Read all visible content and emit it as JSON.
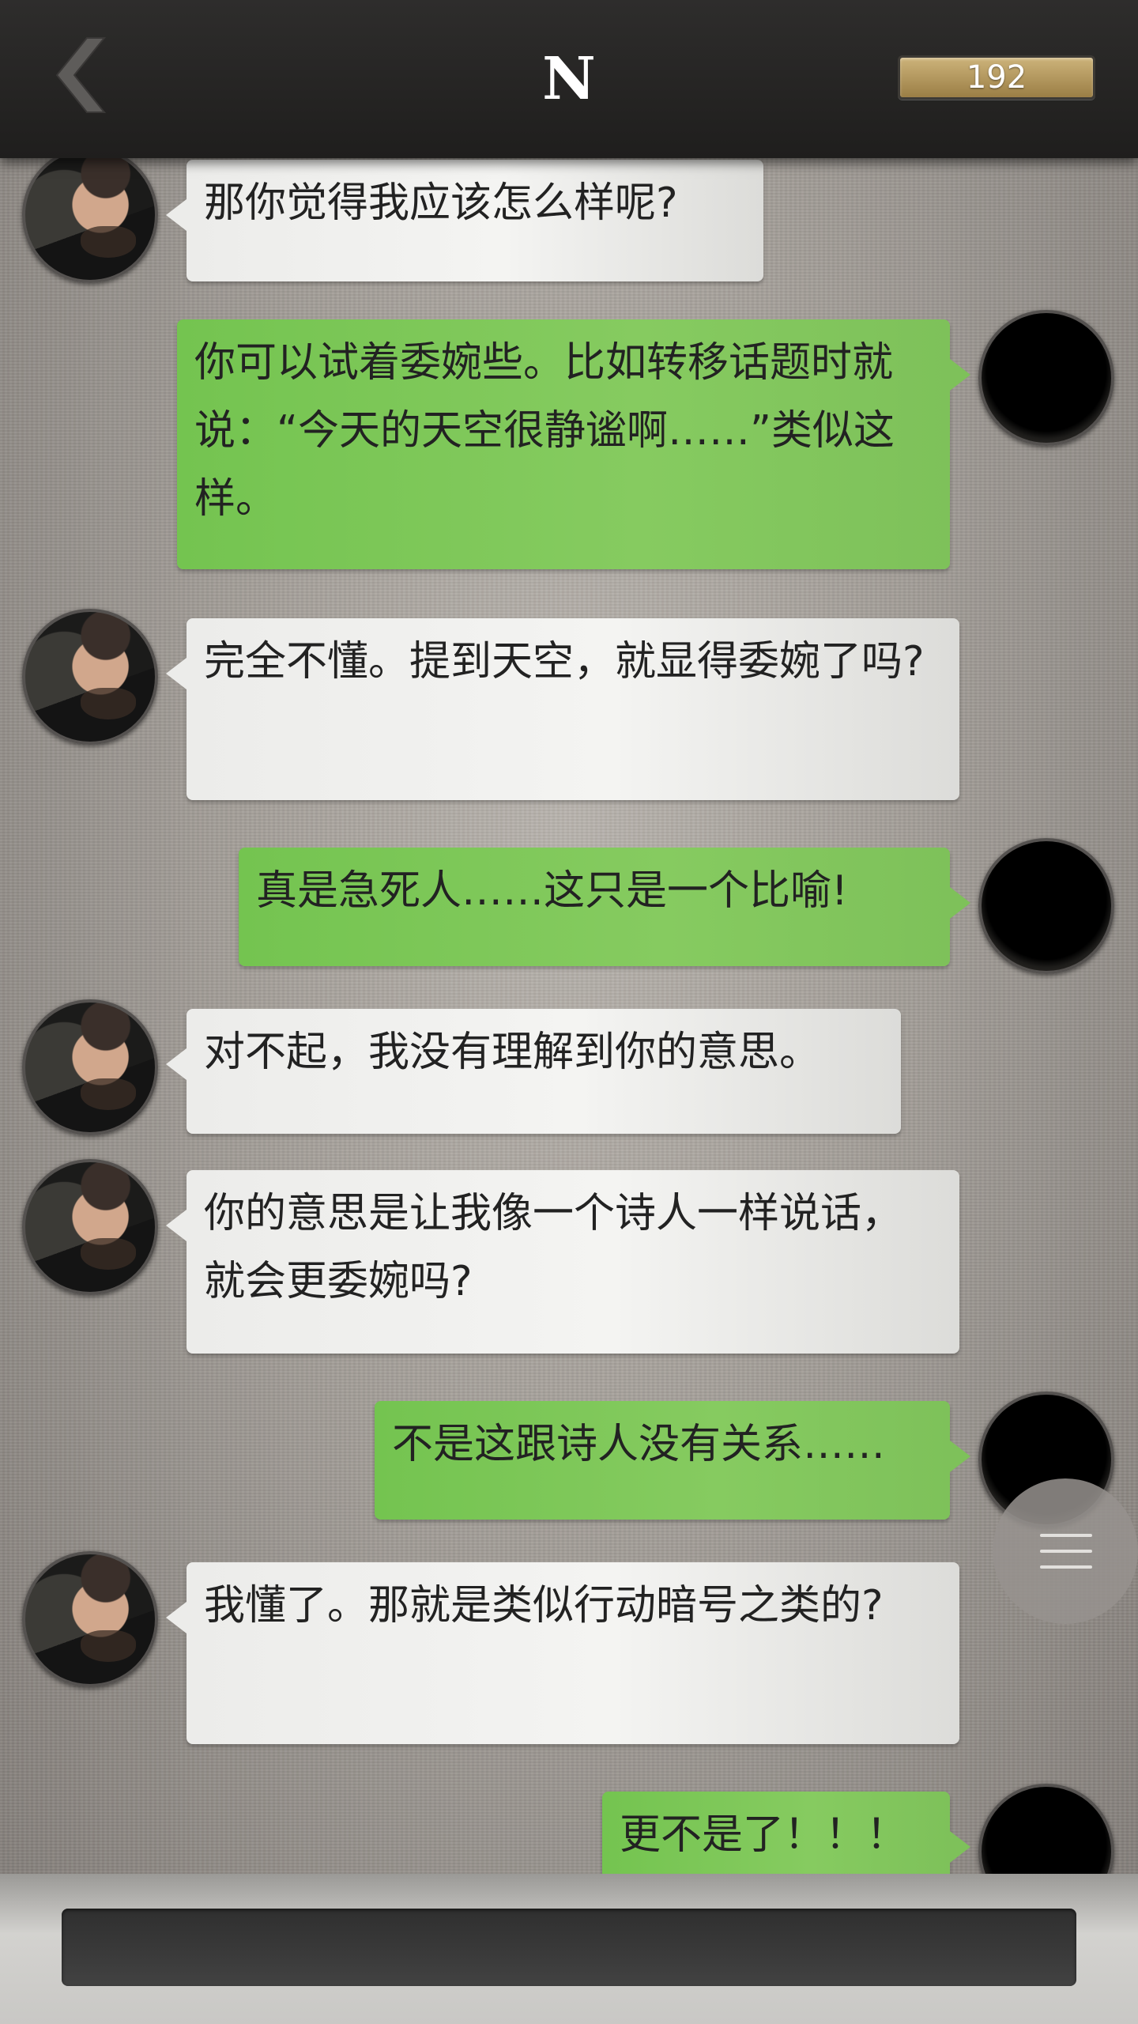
{
  "header": {
    "title": "N",
    "counter": "192",
    "back_icon": "chevron-left-icon"
  },
  "messages": [
    {
      "sender": "npc",
      "text": "那你觉得我应该怎么样呢?"
    },
    {
      "sender": "player",
      "text": "你可以试着委婉些。比如转移话题时就说：“今天的天空很静谧啊……”类似这样。"
    },
    {
      "sender": "npc",
      "text": "完全不懂。提到天空，就显得委婉了吗?"
    },
    {
      "sender": "player",
      "text": "真是急死人……这只是一个比喻!"
    },
    {
      "sender": "npc",
      "text": "对不起，我没有理解到你的意思。"
    },
    {
      "sender": "npc",
      "text": "你的意思是让我像一个诗人一样说话，就会更委婉吗?"
    },
    {
      "sender": "player",
      "text": "不是这跟诗人没有关系……"
    },
    {
      "sender": "npc",
      "text": "我懂了。那就是类似行动暗号之类的?"
    },
    {
      "sender": "player",
      "text": "更不是了！！！"
    }
  ],
  "menu": {
    "icon": "hamburger-menu-icon"
  },
  "colors": {
    "player_bubble": "#7ec15a",
    "npc_bubble": "#ececea",
    "header": "#262524",
    "counter": "#b8995a"
  }
}
